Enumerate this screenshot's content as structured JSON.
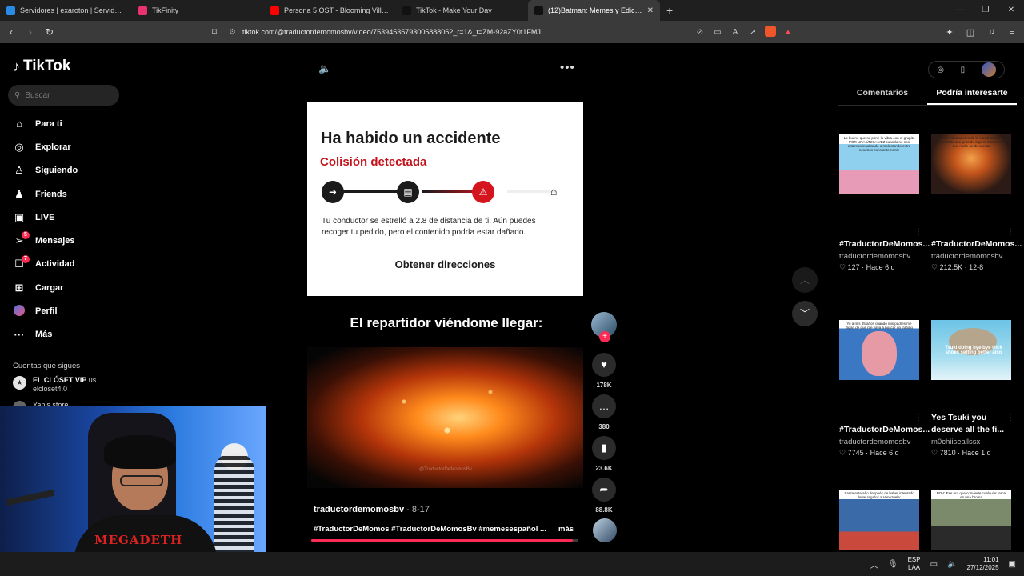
{
  "browser": {
    "tabs": [
      {
        "title": "Servidores | exaroton | Servidores de",
        "color": "#2a8be6",
        "active": false
      },
      {
        "title": "TikFinity",
        "color": "#e8336f",
        "active": false
      },
      {
        "title": "Persona 5 OST - Blooming Villain [Ext",
        "color": "#ff0000",
        "active": false
      },
      {
        "title": "TikTok - Make Your Day",
        "color": "#111111",
        "active": false
      },
      {
        "title": "(12)Batman: Memes y Edicion",
        "color": "#111111",
        "active": true
      }
    ],
    "new_tab": "+",
    "url": "tiktok.com/@traductordemomosbv/video/7539453579300588805?_r=1&_t=ZM-92aZY0t1FMJ"
  },
  "tiktok": {
    "logo": "TikTok",
    "search_placeholder": "Buscar",
    "menu": [
      {
        "label": "Para ti",
        "icon": "home-icon",
        "glyph": "⌂"
      },
      {
        "label": "Explorar",
        "icon": "compass-icon",
        "glyph": "◎"
      },
      {
        "label": "Siguiendo",
        "icon": "following-icon",
        "glyph": "♙"
      },
      {
        "label": "Friends",
        "icon": "friends-icon",
        "glyph": "♟"
      },
      {
        "label": "LIVE",
        "icon": "live-icon",
        "glyph": "▣"
      },
      {
        "label": "Mensajes",
        "icon": "messages-icon",
        "glyph": "➢",
        "badge": "5"
      },
      {
        "label": "Actividad",
        "icon": "activity-icon",
        "glyph": "☐",
        "badge": "7"
      },
      {
        "label": "Cargar",
        "icon": "upload-icon",
        "glyph": "⊞"
      },
      {
        "label": "Perfil",
        "icon": "profile-avatar",
        "glyph": ""
      },
      {
        "label": "Más",
        "icon": "more-icon",
        "glyph": "···"
      }
    ],
    "following_title": "Cuentas que sigues",
    "following": [
      {
        "name": "EL CLÓSET VIP",
        "suffix": "us",
        "handle": "elcloset4.0"
      },
      {
        "name": "Yanis store"
      }
    ]
  },
  "video": {
    "card_title": "Ha habido un accidente",
    "card_subtitle": "Colisión detectada",
    "card_body": "Tu conductor se estrelló a 2.8 de distancia de ti. Aún puedes recoger tu pedido, pero el contenido podría estar dañado.",
    "card_button": "Obtener direcciones",
    "caption": "El repartidor viéndome llegar:",
    "watermark": "@TraductorDeMomosBv",
    "author": "traductordemomosbv",
    "date": "8-17",
    "tags": "#TraductorDeMomos #TraductorDeMomosBv #memesespañol ...",
    "more": "más",
    "progress": 0.98,
    "likes": "178K",
    "comments": "380",
    "saves": "23.6K",
    "shares": "88.8K"
  },
  "right_panel": {
    "tabs": [
      "Comentarios",
      "Podría interesarte"
    ],
    "active_tab": "Podría interesarte",
    "cards": [
      {
        "title": "#TraductorDeMomos...",
        "author": "traductordemomosbv",
        "likes": "127",
        "when": "Hace 6 d",
        "thumb_text": "Lo bueno que se pone la vibra con el grupito POR UNA ÚNICA VEZ cuando no nos estamos insultando o molestando entre nosotros constantemente"
      },
      {
        "title": "#TraductorDeMomos...",
        "author": "traductordemomosbv",
        "likes": "212.5K",
        "when": "12-8",
        "thumb_text": "Los trabajadores de la construcción invocando una grúa de alguna manera sin que nadie se de cuenta"
      },
      {
        "title": "#TraductorDeMomos...",
        "author": "traductordemomosbv",
        "likes": "7745",
        "when": "Hace 6 d",
        "thumb_text": "Yo a mis 45 años cuando mis padres me digan de que me vaya a buscar un trabajo"
      },
      {
        "title": "Yes Tsuki you deserve all the fi...",
        "author": "m0chiiseallssx",
        "likes": "7810",
        "when": "Hace 1 d",
        "thumb_text": "Tsuki doing bye bye trick shoes setting better also"
      },
      {
        "title": "",
        "author": "",
        "likes": "",
        "when": "",
        "thumb_text": "Santa este año después de haber intentado llevar regalos a Venezuela:"
      },
      {
        "title": "",
        "author": "",
        "likes": "",
        "when": "",
        "thumb_text": "POV: Ese bro que convierte cualquier tema en una broma"
      }
    ]
  },
  "taskbar": {
    "lang_top": "ESP",
    "lang_bottom": "LAA",
    "time": "11:01",
    "date": "27/12/2025"
  },
  "webcam": {
    "shirt_text": "MEGADETH"
  }
}
